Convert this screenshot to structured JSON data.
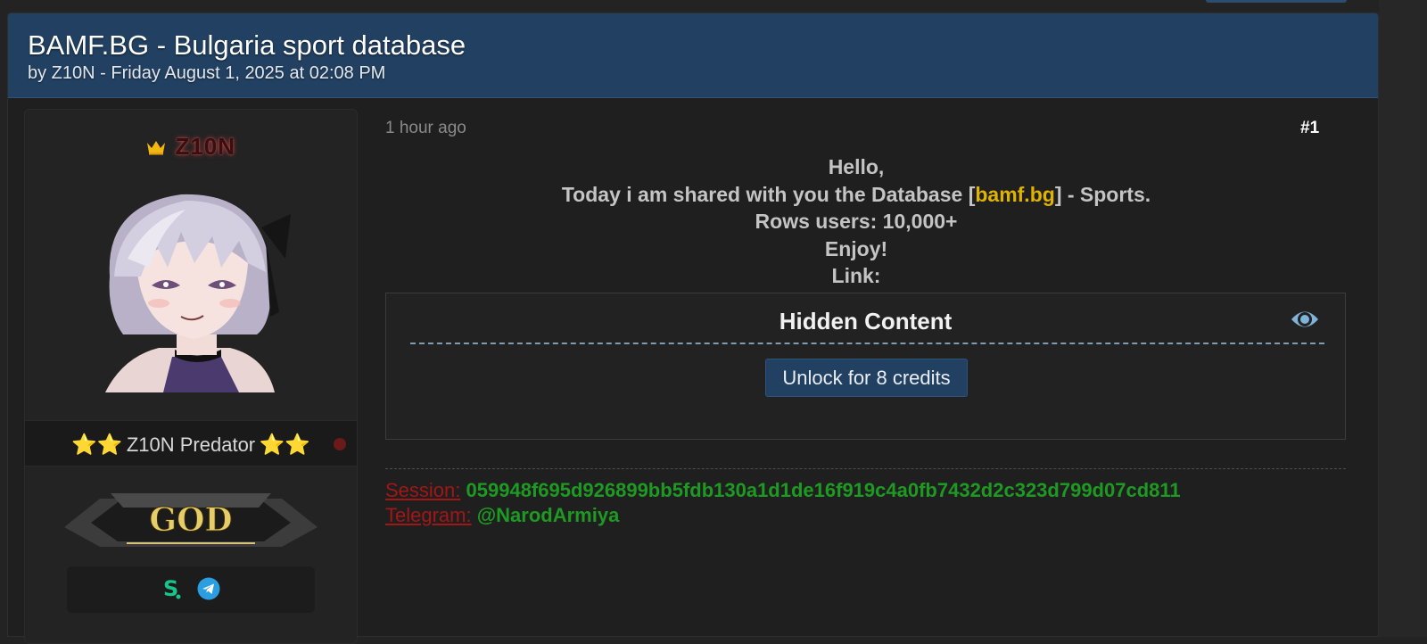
{
  "thread": {
    "title": "BAMF.BG - Bulgaria sport database",
    "meta": "by Z10N - Friday August 1, 2025 at 02:08 PM"
  },
  "author": {
    "name": "Z10N",
    "usertitle": "Z10N Predator",
    "stars_left": "⭐⭐",
    "stars_right": "⭐⭐",
    "rank": "GOD",
    "online": false
  },
  "post": {
    "time": "1 hour ago",
    "number": "#1",
    "line1": "Hello,",
    "line2_prefix": "Today i am shared with you the Database [",
    "line2_link": "bamf.bg",
    "line2_suffix": "] - Sports.",
    "line3": "Rows users: 10,000+",
    "line4": "Enjoy!",
    "line5": "Link:"
  },
  "hidden_content": {
    "title": "Hidden Content",
    "unlock_label": "Unlock for 8 credits"
  },
  "signature": {
    "session_label": "Session:",
    "session_value": "059948f695d926899bb5fdb130a1d1de16f919c4a0fb7432d2c323d799d07cd811",
    "telegram_label": "Telegram:",
    "telegram_value": "@NarodArmiya"
  },
  "icons": {
    "crown": "crown-icon",
    "eye": "eye-icon",
    "session": "session-s-icon",
    "telegram": "telegram-icon"
  },
  "colors": {
    "header_bg": "#224162",
    "link_yellow": "#e0b300",
    "signature_label": "#a31616",
    "signature_value": "#1e9a23"
  }
}
